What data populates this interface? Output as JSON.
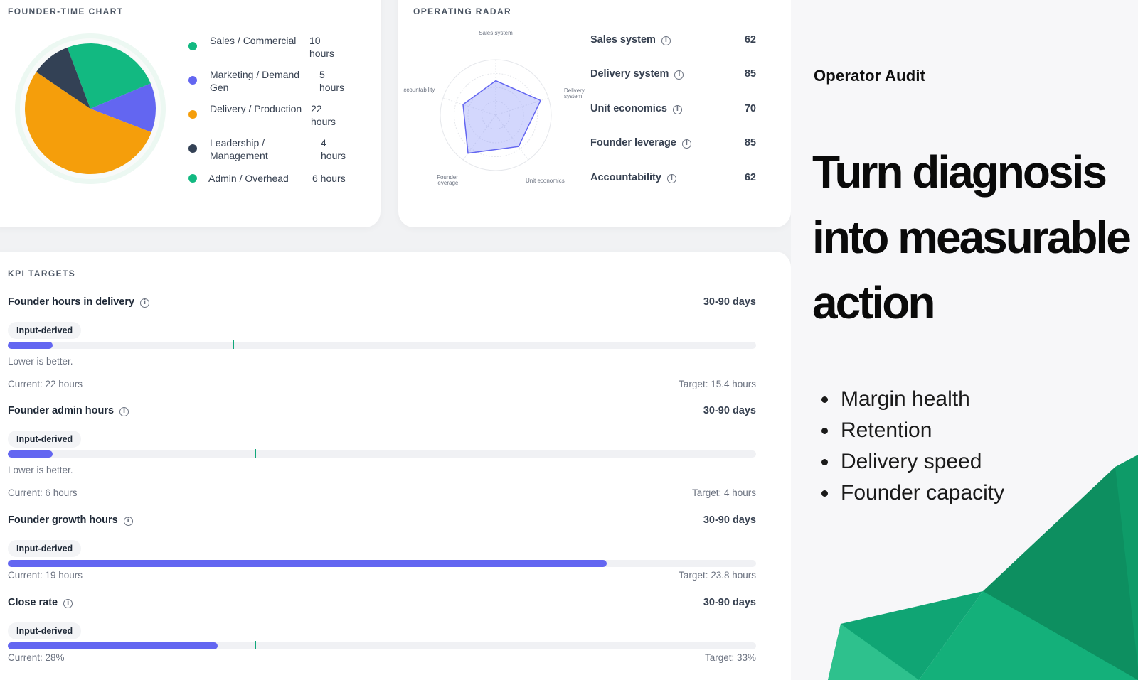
{
  "founder_time": {
    "title": "FOUNDER-TIME CHART",
    "items": [
      {
        "label": "Sales / Commercial",
        "value": "10 hours",
        "hours": 10,
        "color": "#12b981"
      },
      {
        "label": "Marketing / Demand Gen",
        "value": "5 hours",
        "hours": 5,
        "color": "#6366f1"
      },
      {
        "label": "Delivery / Production",
        "value": "22 hours",
        "hours": 22,
        "color": "#f59e0b"
      },
      {
        "label": "Leadership / Management",
        "value": "4 hours",
        "hours": 4,
        "color": "#334155"
      },
      {
        "label": "Admin / Overhead",
        "value": "6 hours",
        "hours": 6,
        "color": "#12b981"
      }
    ]
  },
  "radar": {
    "title": "OPERATING RADAR",
    "axes": [
      {
        "label": "Sales system",
        "score": 62
      },
      {
        "label": "Delivery system",
        "score": 85
      },
      {
        "label": "Unit economics",
        "score": 70
      },
      {
        "label": "Founder leverage",
        "score": 85
      },
      {
        "label": "Accountability",
        "score": 62
      }
    ],
    "info_glyph": "i"
  },
  "kpi": {
    "title": "KPI TARGETS",
    "items": [
      {
        "name": "Founder hours in delivery",
        "window": "30-90 days",
        "badge": "Input-derived",
        "note": "Lower is better.",
        "current": "Current: 22 hours",
        "target": "Target: 15.4 hours",
        "fill_fraction": 0.06,
        "target_fraction": 0.3
      },
      {
        "name": "Founder admin hours",
        "window": "30-90 days",
        "badge": "Input-derived",
        "note": "Lower is better.",
        "current": "Current: 6 hours",
        "target": "Target: 4 hours",
        "fill_fraction": 0.06,
        "target_fraction": 0.33
      },
      {
        "name": "Founder growth hours",
        "window": "30-90 days",
        "badge": "Input-derived",
        "note": "",
        "current": "Current: 19 hours",
        "target": "Target: 23.8 hours",
        "fill_fraction": 0.8,
        "target_fraction": null
      },
      {
        "name": "Close rate",
        "window": "30-90 days",
        "badge": "Input-derived",
        "note": "",
        "current": "Current: 28%",
        "target": "Target: 33%",
        "fill_fraction": 0.28,
        "target_fraction": 0.33
      }
    ]
  },
  "promo": {
    "brand": "Operator Audit",
    "headline_lines": [
      "Turn diagnosis",
      "into measurable",
      "action"
    ],
    "bullets": [
      "Margin health",
      "Retention",
      "Delivery speed",
      "Founder capacity"
    ]
  },
  "colors": {
    "accent": "#6366f1",
    "target_mark": "#10a77a",
    "deco_green": "#0f9a68"
  }
}
